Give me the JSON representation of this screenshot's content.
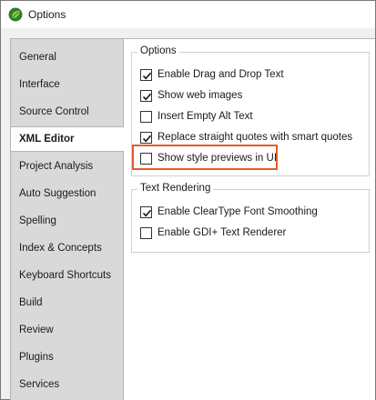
{
  "window": {
    "title": "Options",
    "icon": "leaf-app-icon",
    "accent_color": "#e55b2a"
  },
  "sidebar": {
    "items": [
      {
        "label": "General",
        "active": false
      },
      {
        "label": "Interface",
        "active": false
      },
      {
        "label": "Source Control",
        "active": false
      },
      {
        "label": "XML Editor",
        "active": true
      },
      {
        "label": "Project Analysis",
        "active": false
      },
      {
        "label": "Auto Suggestion",
        "active": false
      },
      {
        "label": "Spelling",
        "active": false
      },
      {
        "label": "Index & Concepts",
        "active": false
      },
      {
        "label": "Keyboard Shortcuts",
        "active": false
      },
      {
        "label": "Build",
        "active": false
      },
      {
        "label": "Review",
        "active": false
      },
      {
        "label": "Plugins",
        "active": false
      },
      {
        "label": "Services",
        "active": false
      }
    ]
  },
  "options_group": {
    "label": "Options",
    "items": [
      {
        "label": "Enable Drag and Drop Text",
        "checked": true
      },
      {
        "label": "Show web images",
        "checked": true
      },
      {
        "label": "Insert Empty Alt Text",
        "checked": false
      },
      {
        "label": "Replace straight quotes with smart quotes",
        "checked": true
      },
      {
        "label": "Show style previews in UI",
        "checked": false,
        "highlighted": true
      }
    ]
  },
  "text_rendering_group": {
    "label": "Text Rendering",
    "items": [
      {
        "label": "Enable ClearType Font Smoothing",
        "checked": true
      },
      {
        "label": "Enable GDI+ Text Renderer",
        "checked": false
      }
    ]
  }
}
